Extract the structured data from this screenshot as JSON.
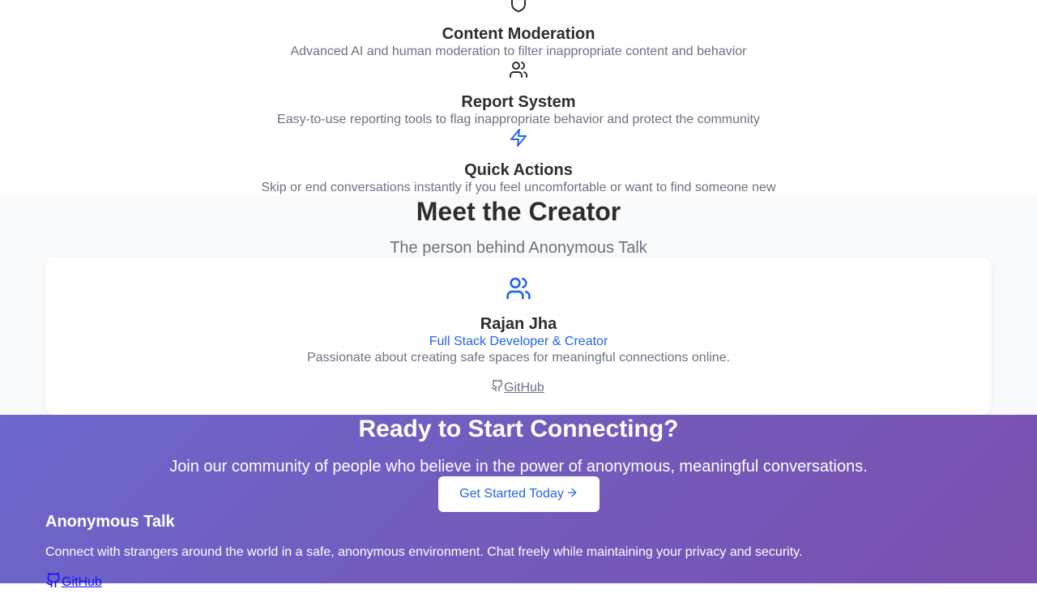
{
  "features": [
    {
      "icon": "shield-icon",
      "title": "Content Moderation",
      "description": "Advanced AI and human moderation to filter inappropriate content and behavior",
      "color": "#2d2d2d"
    },
    {
      "icon": "users-icon",
      "title": "Report System",
      "description": "Easy-to-use reporting tools to flag inappropriate behavior and protect the community",
      "color": "#2d2d2d"
    },
    {
      "icon": "zap-icon",
      "title": "Quick Actions",
      "description": "Skip or end conversations instantly if you feel uncomfortable or want to find someone new",
      "color": "#2563eb"
    }
  ],
  "creator_section": {
    "title": "Meet the Creator",
    "subtitle": "The person behind Anonymous Talk",
    "card": {
      "icon": "users-icon",
      "name": "Rajan Jha",
      "role": "Full Stack Developer & Creator",
      "bio": "Passionate about creating safe spaces for meaningful connections online.",
      "github_label": "GitHub"
    }
  },
  "cta": {
    "title": "Ready to Start Connecting?",
    "lead": "Join our community of people who believe in the power of anonymous, meaningful conversations.",
    "button_label": "Get Started Today"
  },
  "footer": {
    "brand": "Anonymous Talk",
    "description": "Connect with strangers around the world in a safe, anonymous environment. Chat freely while maintaining your privacy and security.",
    "github_label": "GitHub"
  },
  "colors": {
    "accent": "#2563eb",
    "heading": "#2d2d2d",
    "muted": "#6b7280",
    "gradient_start": "#6c67cc",
    "gradient_end": "#7a4fad"
  }
}
